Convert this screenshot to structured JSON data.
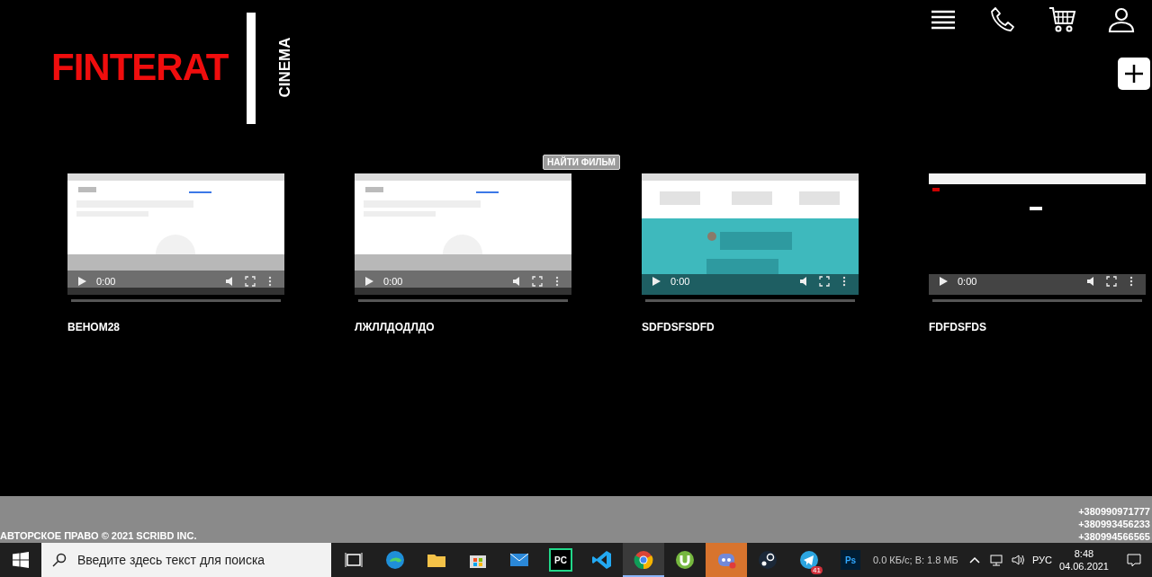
{
  "logo": {
    "name": "FINTERAT",
    "tagline": "CINEMA"
  },
  "search_button": {
    "label": "НАЙТИ ФИЛЬМ"
  },
  "videos": [
    {
      "title": "ВЕНОМ28",
      "time": "0:00",
      "kind": "picture"
    },
    {
      "title": "ЛЖЛЛДОДЛДО",
      "time": "0:00",
      "kind": "picture"
    },
    {
      "title": "SDFDSFSDFD",
      "time": "0:00",
      "kind": "picture"
    },
    {
      "title": "FDFDSFDS",
      "time": "0:00",
      "kind": "picture"
    }
  ],
  "footer": {
    "copyright": "АВТОРСКОЕ ПРАВО © 2021 SCRIBD INC.",
    "phones": [
      "+380990971777",
      "+380993456233",
      "+380994566565"
    ]
  },
  "taskbar": {
    "search": {
      "placeholder": "Введите здесь текст для поиска"
    },
    "apps": [
      {
        "kind": "taskview",
        "selected": false,
        "attention": false
      },
      {
        "kind": "edge",
        "selected": false,
        "attention": false
      },
      {
        "kind": "folder",
        "selected": false,
        "attention": false
      },
      {
        "kind": "store",
        "selected": false,
        "attention": false
      },
      {
        "kind": "mail",
        "selected": false,
        "attention": false
      },
      {
        "kind": "pycharm",
        "label": "PC",
        "selected": false,
        "attention": false
      },
      {
        "kind": "vscode",
        "selected": false,
        "attention": false
      },
      {
        "kind": "chrome",
        "selected": true,
        "attention": false
      },
      {
        "kind": "torrent",
        "selected": false,
        "attention": false
      },
      {
        "kind": "discord",
        "selected": false,
        "attention": true
      },
      {
        "kind": "steam",
        "selected": false,
        "attention": false
      },
      {
        "kind": "telegram",
        "badge": "41",
        "selected": false,
        "attention": false
      },
      {
        "kind": "photoshop",
        "label": "Ps",
        "selected": false,
        "attention": false
      }
    ],
    "speed": "0.0 КБ/с; В: 1.8 МБ",
    "language": "РУС",
    "time": "8:48",
    "date": "04.06.2021"
  }
}
